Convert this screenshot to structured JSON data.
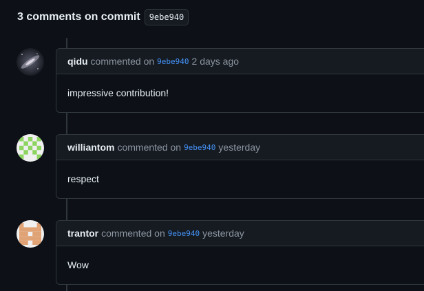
{
  "heading": {
    "text": "3 comments on commit",
    "commit_sha": "9ebe940"
  },
  "comments": [
    {
      "author": "qidu",
      "action": "commented on",
      "commit_sha": "9ebe940",
      "timestamp": "2 days ago",
      "body": "impressive contribution!",
      "avatar": "galaxy-photo"
    },
    {
      "author": "williantom",
      "action": "commented on",
      "commit_sha": "9ebe940",
      "timestamp": "yesterday",
      "body": "respect",
      "avatar": "identicon-green"
    },
    {
      "author": "trantor",
      "action": "commented on",
      "commit_sha": "9ebe940",
      "timestamp": "yesterday",
      "body": "Wow",
      "avatar": "identicon-orange"
    }
  ],
  "colors": {
    "background": "#0d1117",
    "header_bg": "#161b22",
    "border": "#30363d",
    "link": "#4493f8",
    "muted_text": "#8d96a0",
    "identicon_green": "#8dd461",
    "identicon_orange": "#e0a376"
  }
}
